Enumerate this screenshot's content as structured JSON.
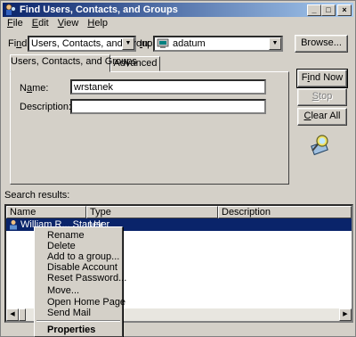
{
  "window": {
    "title": "Find Users, Contacts, and Groups",
    "controls": {
      "minimize": "_",
      "maximize": "□",
      "close": "×"
    }
  },
  "menubar": {
    "items": [
      {
        "pre": "",
        "u": "F",
        "post": "ile"
      },
      {
        "pre": "",
        "u": "E",
        "post": "dit"
      },
      {
        "pre": "",
        "u": "V",
        "post": "iew"
      },
      {
        "pre": "",
        "u": "H",
        "post": "elp"
      }
    ]
  },
  "find": {
    "label_pre": "Fi",
    "label_u": "n",
    "label_post": "d:",
    "value": "Users, Contacts, and Groups"
  },
  "in": {
    "label_pre": "",
    "label_u": "I",
    "label_post": "n:",
    "value": "adatum"
  },
  "browse_label": "Browse...",
  "tabs": {
    "active": "Users, Contacts, and Groups",
    "other": "Advanced"
  },
  "form": {
    "name_label_pre": "N",
    "name_label_u": "a",
    "name_label_post": "me:",
    "name_value": "wrstanek",
    "description_label": "Description:",
    "description_value": ""
  },
  "buttons": {
    "find_now": {
      "pre": "F",
      "u": "i",
      "post": "nd Now"
    },
    "stop": {
      "pre": "",
      "u": "S",
      "post": "top"
    },
    "clear_all": {
      "pre": "",
      "u": "C",
      "post": "lear All"
    }
  },
  "results": {
    "label": "Search results:",
    "columns": [
      "Name",
      "Type",
      "Description"
    ],
    "rows": [
      {
        "name": "William R... Stanek",
        "type": "User",
        "description": ""
      }
    ]
  },
  "context_menu": {
    "items": [
      "Rename",
      "Delete",
      "Add to a group...",
      "Disable Account",
      "Reset Password...",
      "Move...",
      "Open Home Page",
      "Send Mail"
    ],
    "default_item": "Properties"
  },
  "colors": {
    "title_start": "#0a246a",
    "title_end": "#a6caf0",
    "selection": "#0a246a",
    "face": "#d4d0c8"
  }
}
